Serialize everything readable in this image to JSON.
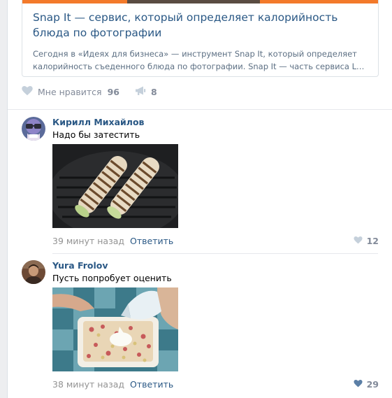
{
  "shared_link": {
    "title": "Snap It — сервис, который определяет калорийность блюда по фотографии",
    "description_line1": "Сегодня в «Идеях для бизнеса» — инструмент Snap It, который определяет",
    "description_line2": "калорийность съеденного блюда по фотографии. Snap It — часть сервиса Lose …"
  },
  "post_actions": {
    "like_label": "Мне нравится",
    "like_count": "96",
    "share_count": "8"
  },
  "comments": [
    {
      "author": "Кирилл Михайлов",
      "text": "Надо бы затестить",
      "time": "39 минут назад",
      "reply_label": "Ответить",
      "likes": "12",
      "liked": false
    },
    {
      "author": "Yura Frolov",
      "text": "Пусть попробует оценить",
      "time": "38 минут назад",
      "reply_label": "Ответить",
      "likes": "29",
      "liked": true
    }
  ],
  "colors": {
    "link": "#2a5885",
    "muted": "#828a99",
    "accent_strip": "#f37a2b",
    "liked_heart": "#5b7fa6"
  }
}
